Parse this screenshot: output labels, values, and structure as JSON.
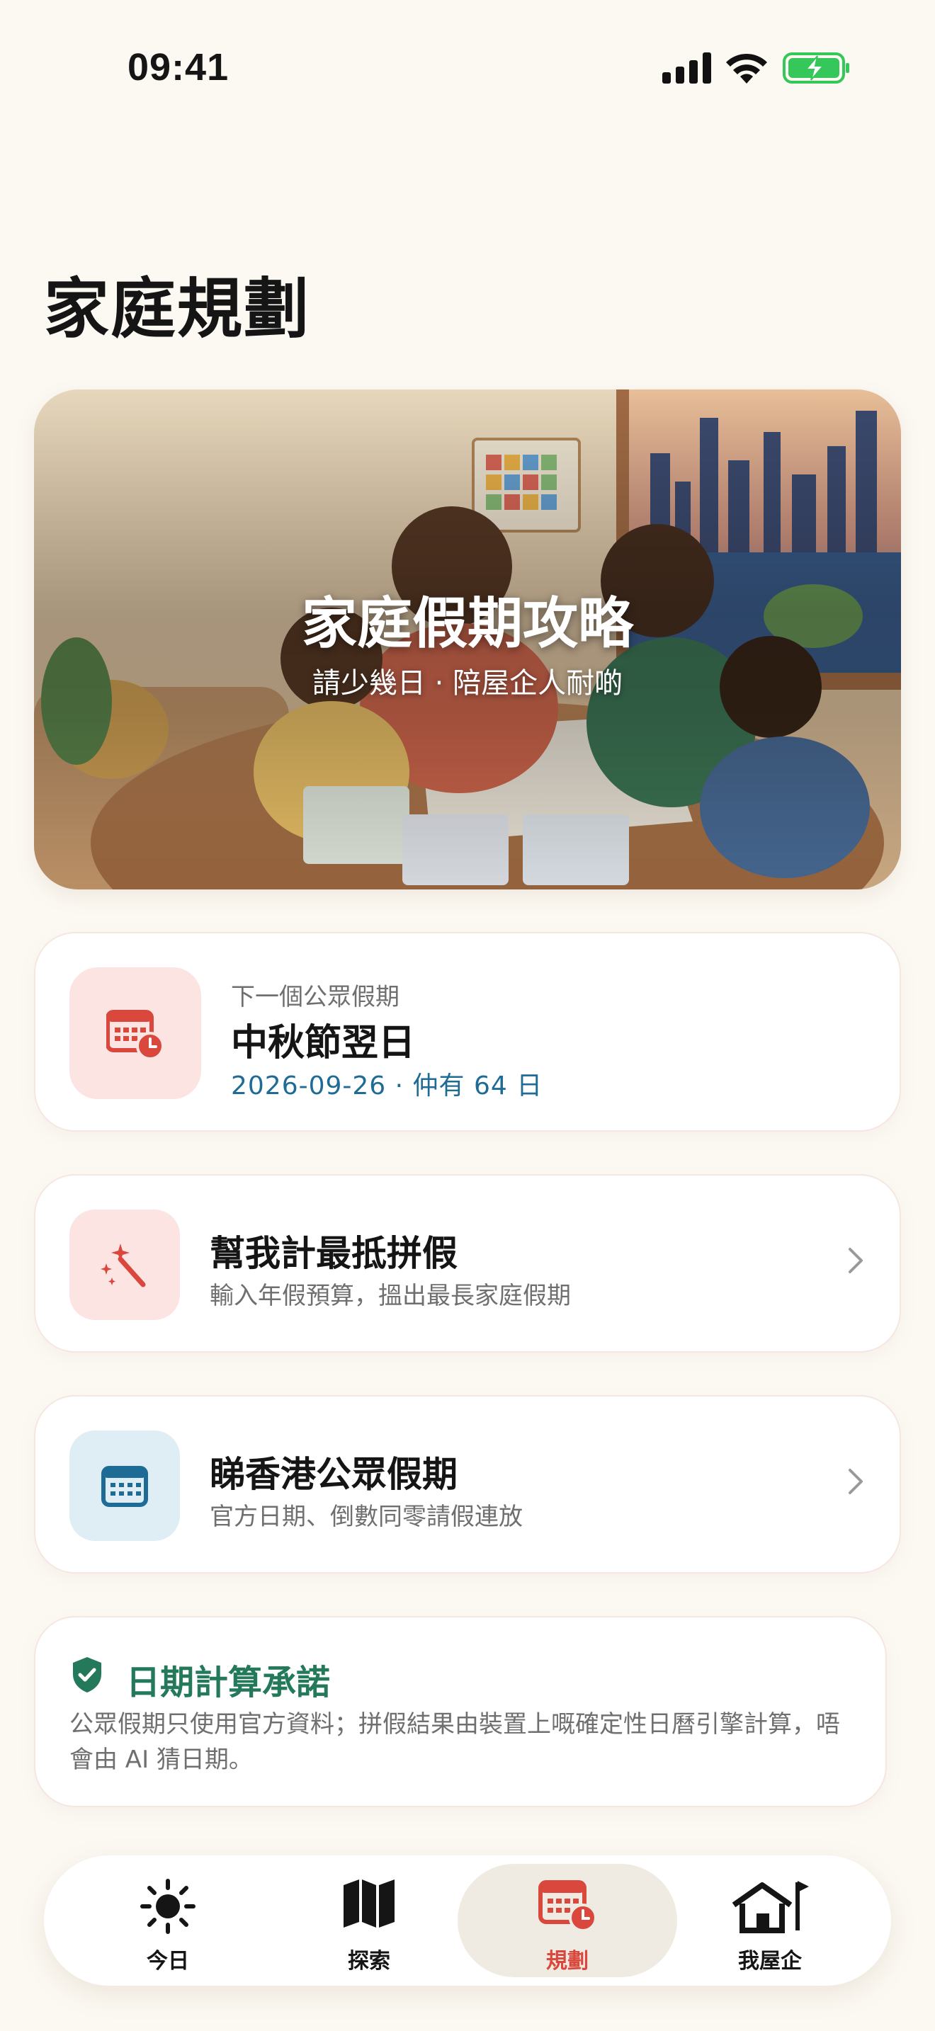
{
  "status_bar": {
    "time": "09:41"
  },
  "page": {
    "title": "家庭規劃"
  },
  "hero": {
    "title": "家庭假期攻略",
    "subtitle": "請少幾日 · 陪屋企人耐啲"
  },
  "next_holiday": {
    "eyebrow": "下一個公眾假期",
    "name": "中秋節翌日",
    "date_countdown": "2026-09-26 · 仲有 64 日",
    "icon": "calendar-clock-icon"
  },
  "actions": [
    {
      "title": "幫我計最抵拼假",
      "subtitle": "輸入年假預算，搵出最長家庭假期",
      "icon": "magic-wand-icon"
    },
    {
      "title": "睇香港公眾假期",
      "subtitle": "官方日期、倒數同零請假連放",
      "icon": "calendar-icon"
    }
  ],
  "promise": {
    "title": "日期計算承諾",
    "body": "公眾假期只使用官方資料；拼假結果由裝置上嘅確定性日曆引擎計算，唔會由 AI 猜日期。",
    "icon": "shield-check-icon"
  },
  "tab_bar": {
    "tabs": [
      {
        "label": "今日",
        "icon": "sun-icon",
        "active": false
      },
      {
        "label": "探索",
        "icon": "map-icon",
        "active": false
      },
      {
        "label": "規劃",
        "icon": "calendar-clock-icon",
        "active": true
      },
      {
        "label": "我屋企",
        "icon": "home-flag-icon",
        "active": false
      }
    ]
  },
  "colors": {
    "background": "#fcf9f3",
    "accent_red": "#d9473d",
    "link_blue": "#1e6b96",
    "promise_green": "#24795a",
    "battery_green": "#35c759"
  }
}
